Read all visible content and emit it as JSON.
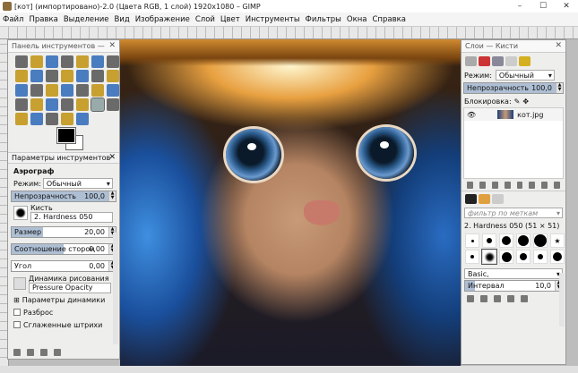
{
  "window": {
    "title": "[кот] (импортировано)-2.0 (Цвета RGB, 1 слой) 1920x1080 – GIMP",
    "minimize": "–",
    "maximize": "☐",
    "close": "✕"
  },
  "menu": [
    "Файл",
    "Правка",
    "Выделение",
    "Вид",
    "Изображение",
    "Слой",
    "Цвет",
    "Инструменты",
    "Фильтры",
    "Окна",
    "Справка"
  ],
  "toolbox": {
    "title": "Панель инструментов —",
    "close": "✕"
  },
  "tool_options": {
    "tab_label": "Параметры инструментов",
    "tool_name": "Аэрограф",
    "mode_label": "Режим:",
    "mode_value": "Обычный",
    "opacity_label": "Непрозрачность",
    "opacity_value": "100,0",
    "opacity_fraction": 1.0,
    "brush_label": "Кисть",
    "brush_value": "2. Hardness 050",
    "size_label": "Размер",
    "size_value": "20,00",
    "ratio_label": "Соотношение сторон",
    "ratio_value": "0,00",
    "angle_label": "Угол",
    "angle_value": "0,00",
    "dynamics_label": "Динамика рисования",
    "dynamics_value": "Pressure Opacity",
    "dynamics_params": "Параметры динамики",
    "jitter": "Разброс",
    "smooth": "Сглаженные штрихи"
  },
  "layers": {
    "title": "Слои — Кисти",
    "mode_label": "Режим:",
    "mode_value": "Обычный",
    "opacity_label": "Непрозрачность",
    "opacity_value": "100,0",
    "lock_label": "Блокировка:",
    "layer_name": "кот.jpg"
  },
  "brushes": {
    "filter_placeholder": "фильтр по меткам",
    "current": "2. Hardness 050 (51 × 51)",
    "preset": "Basic,",
    "spacing_label": "Интервал",
    "spacing_value": "10,0"
  },
  "colors": {
    "accent": "#aebfd4",
    "foreground": "#000000",
    "background": "#ffffff"
  }
}
